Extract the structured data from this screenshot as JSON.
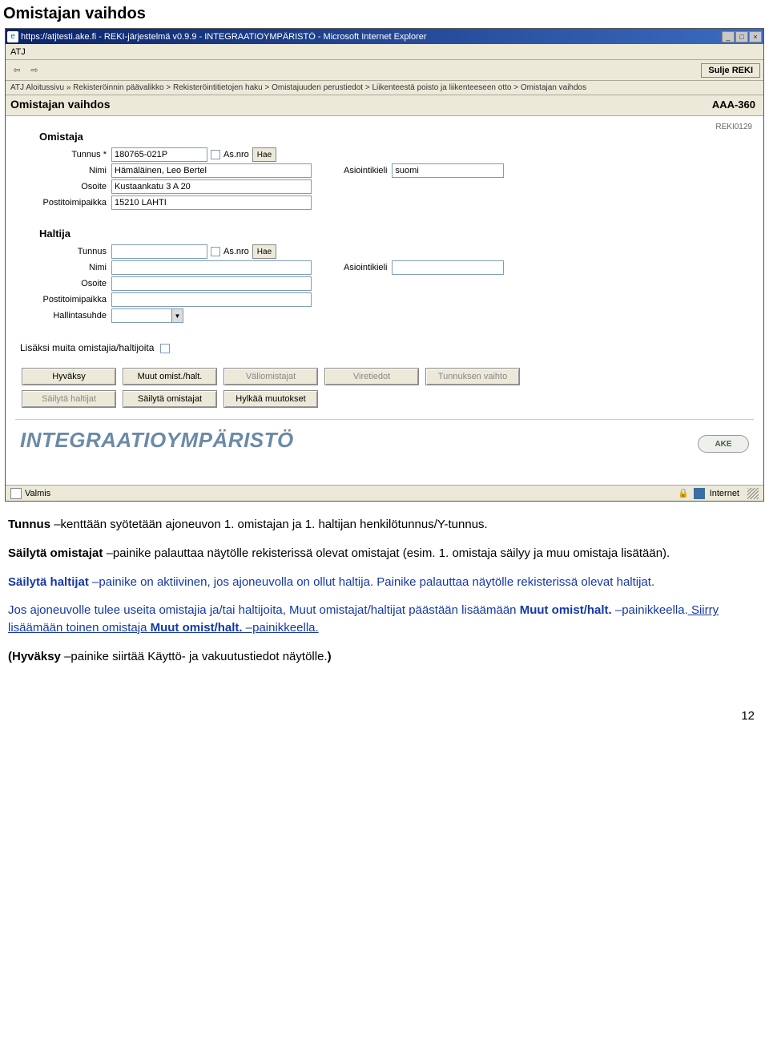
{
  "doc": {
    "title": "Omistajan vaihdos"
  },
  "window": {
    "titlebar": "https://atjtesti.ake.fi - REKI-järjestelmä v0.9.9 - INTEGRAATIOYMPÄRISTÖ - Microsoft Internet Explorer",
    "menu": "ATJ",
    "close_reki": "Sulje REKI",
    "breadcrumb": "ATJ Aloitussivu » Rekisteröinnin päävalikko > Rekisteröintitietojen haku > Omistajuuden perustiedot > Liikenteestä poisto ja liikenteeseen otto > Omistajan vaihdos",
    "page_title": "Omistajan vaihdos",
    "page_code": "AAA-360",
    "screen_code": "REKI0129",
    "env_title": "INTEGRAATIOYMPÄRISTÖ",
    "ake_logo": "AKE",
    "status_text": "Valmis",
    "status_net": "Internet"
  },
  "omistaja": {
    "section": "Omistaja",
    "tunnus_label": "Tunnus *",
    "tunnus_value": "180765-021P",
    "asnro_label": "As.nro",
    "hae": "Hae",
    "nimi_label": "Nimi",
    "nimi_value": "Hämäläinen, Leo Bertel",
    "asiointikieli_label": "Asiointikieli",
    "asiointikieli_value": "suomi",
    "osoite_label": "Osoite",
    "osoite_value": "Kustaankatu 3 A 20",
    "postitoimipaikka_label": "Postitoimipaikka",
    "postitoimipaikka_value": "15210 LAHTI"
  },
  "haltija": {
    "section": "Haltija",
    "tunnus_label": "Tunnus",
    "tunnus_value": "",
    "asnro_label": "As.nro",
    "hae": "Hae",
    "nimi_label": "Nimi",
    "nimi_value": "",
    "asiointikieli_label": "Asiointikieli",
    "asiointikieli_value": "",
    "osoite_label": "Osoite",
    "osoite_value": "",
    "postitoimipaikka_label": "Postitoimipaikka",
    "postitoimipaikka_value": "",
    "hallintasuhde_label": "Hallintasuhde"
  },
  "extra": {
    "label": "Lisäksi muita omistajia/haltijoita"
  },
  "buttons": {
    "hyvaksy": "Hyväksy",
    "muut": "Muut omist./halt.",
    "valiomistajat": "Väliomistajat",
    "viretiedot": "Viretiedot",
    "tunnuksen": "Tunnuksen vaihto",
    "sailyta_haltijat": "Säilytä haltijat",
    "sailyta_omistajat": "Säilytä omistajat",
    "hylkaa": "Hylkää muutokset"
  },
  "body": {
    "p1a": "Tunnus ",
    "p1b": "–kenttään syötetään ajoneuvon 1. omistajan ja 1. haltijan henkilötunnus/Y-tunnus.",
    "p2a": "Säilytä omistajat ",
    "p2b": "–painike palauttaa näytölle rekisterissä olevat omistajat (esim. 1. omistaja säilyy ja muu omistaja lisätään).",
    "p3a": "Säilytä haltijat ",
    "p3b": "–painike on aktiivinen, jos ajoneuvolla on ollut haltija. Painike palauttaa näytölle rekisterissä olevat haltijat.",
    "p4a": "Jos ajoneuvolle tulee useita omistajia ja/tai haltijoita, Muut omistajat/haltijat  päästään lisäämään ",
    "p4b": "Muut omist/halt. ",
    "p4c": "–painikkeella.",
    "p4d": " Siirry lisäämään toinen omistaja ",
    "p4e": "Muut omist/halt.",
    "p4f": " –painikkeella.",
    "p5a": "(Hyväksy ",
    "p5b": "–painike siirtää Käyttö- ja vakuutustiedot näytölle.",
    "p5c": ")"
  },
  "page_number": "12"
}
